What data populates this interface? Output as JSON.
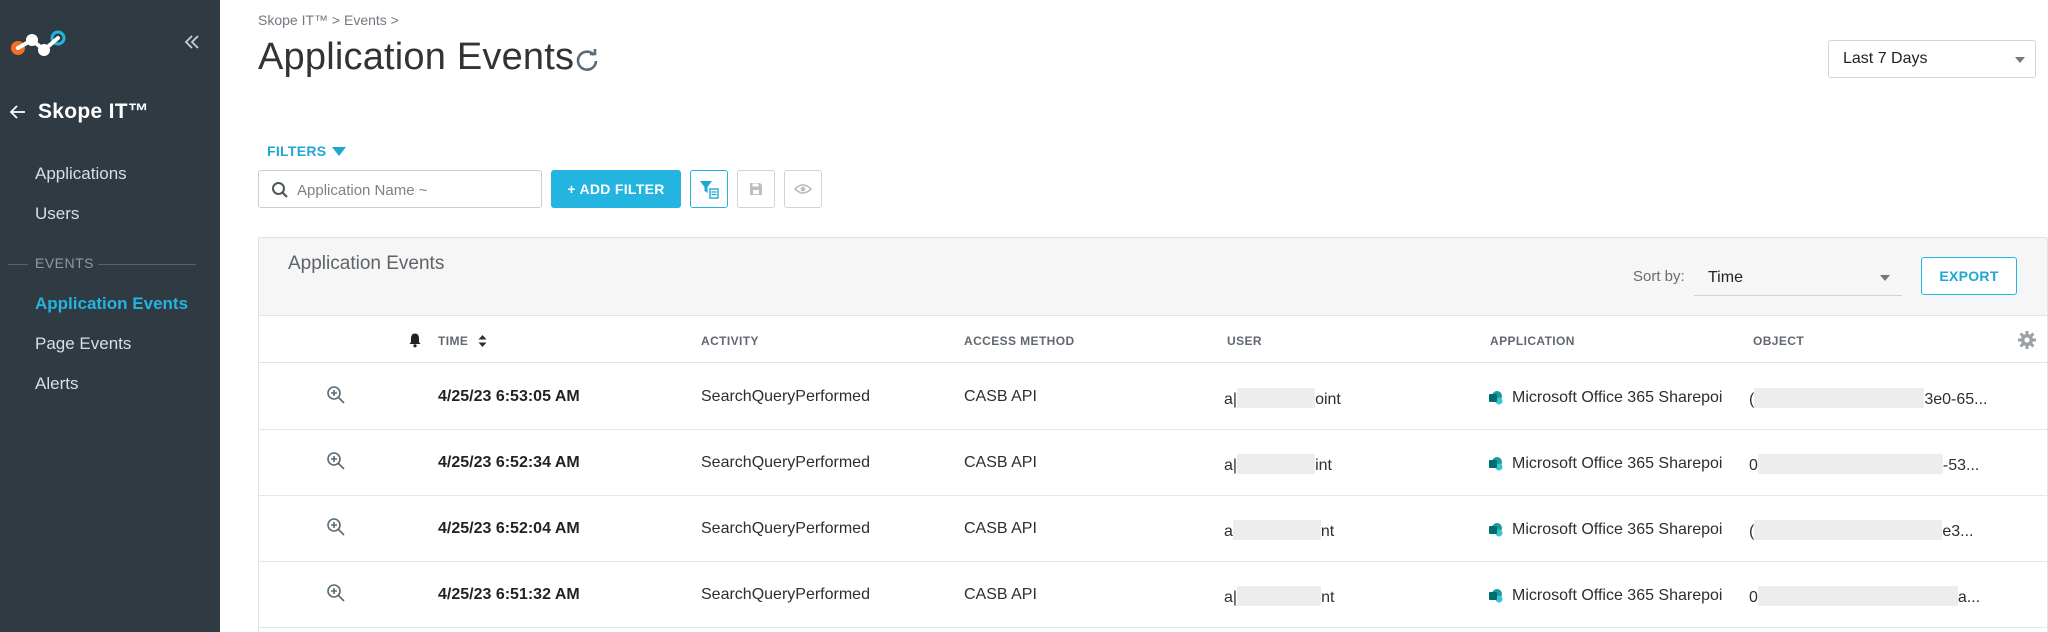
{
  "sidebar": {
    "logo": "netskope-logo-icon",
    "collapse_icon": "double-chevron-left-icon",
    "back_icon": "arrow-left-icon",
    "title": "Skope IT™",
    "nav_primary": [
      {
        "label": "Applications"
      },
      {
        "label": "Users"
      }
    ],
    "section_label": "EVENTS",
    "nav_events": [
      {
        "label": "Application Events",
        "active": true
      },
      {
        "label": "Page Events"
      },
      {
        "label": "Alerts"
      }
    ]
  },
  "header": {
    "breadcrumb": "Skope IT™ > Events >",
    "title": "Application Events",
    "refresh_icon": "refresh-icon",
    "time_range": "Last 7 Days"
  },
  "filters": {
    "toggle_label": "FILTERS",
    "search_placeholder": "Application Name ~",
    "add_filter_label": "+ ADD FILTER",
    "icons": [
      "filter-settings-icon",
      "save-icon",
      "eye-icon"
    ]
  },
  "panel": {
    "title": "Application Events",
    "sort_label": "Sort by:",
    "sort_value": "Time",
    "export_label": "EXPORT",
    "columns": {
      "time": "TIME",
      "activity": "ACTIVITY",
      "access_method": "ACCESS METHOD",
      "user": "USER",
      "application": "APPLICATION",
      "object": "OBJECT"
    },
    "rows": [
      {
        "time": "4/25/23 6:53:05 AM",
        "activity": "SearchQueryPerformed",
        "access_method": "CASB API",
        "user_pre": "a|",
        "user_post": "oint",
        "application": "Microsoft Office 365 Sharepoi",
        "obj_pre": "(",
        "obj_post": "3e0-65..."
      },
      {
        "time": "4/25/23 6:52:34 AM",
        "activity": "SearchQueryPerformed",
        "access_method": "CASB API",
        "user_pre": "a|",
        "user_post": "int",
        "application": "Microsoft Office 365 Sharepoi",
        "obj_pre": "0",
        "obj_post": "-53..."
      },
      {
        "time": "4/25/23 6:52:04 AM",
        "activity": "SearchQueryPerformed",
        "access_method": "CASB API",
        "user_pre": "a",
        "user_post": "nt",
        "application": "Microsoft Office 365 Sharepoi",
        "obj_pre": "(",
        "obj_post": "e3..."
      },
      {
        "time": "4/25/23 6:51:32 AM",
        "activity": "SearchQueryPerformed",
        "access_method": "CASB API",
        "user_pre": "a|",
        "user_post": "nt",
        "application": "Microsoft Office 365 Sharepoi",
        "obj_pre": "0",
        "obj_post": "a..."
      }
    ]
  },
  "colors": {
    "sidebar_bg": "#2f3a42",
    "accent": "#23b4e0",
    "sharepoint_teal": "#138a8a"
  }
}
